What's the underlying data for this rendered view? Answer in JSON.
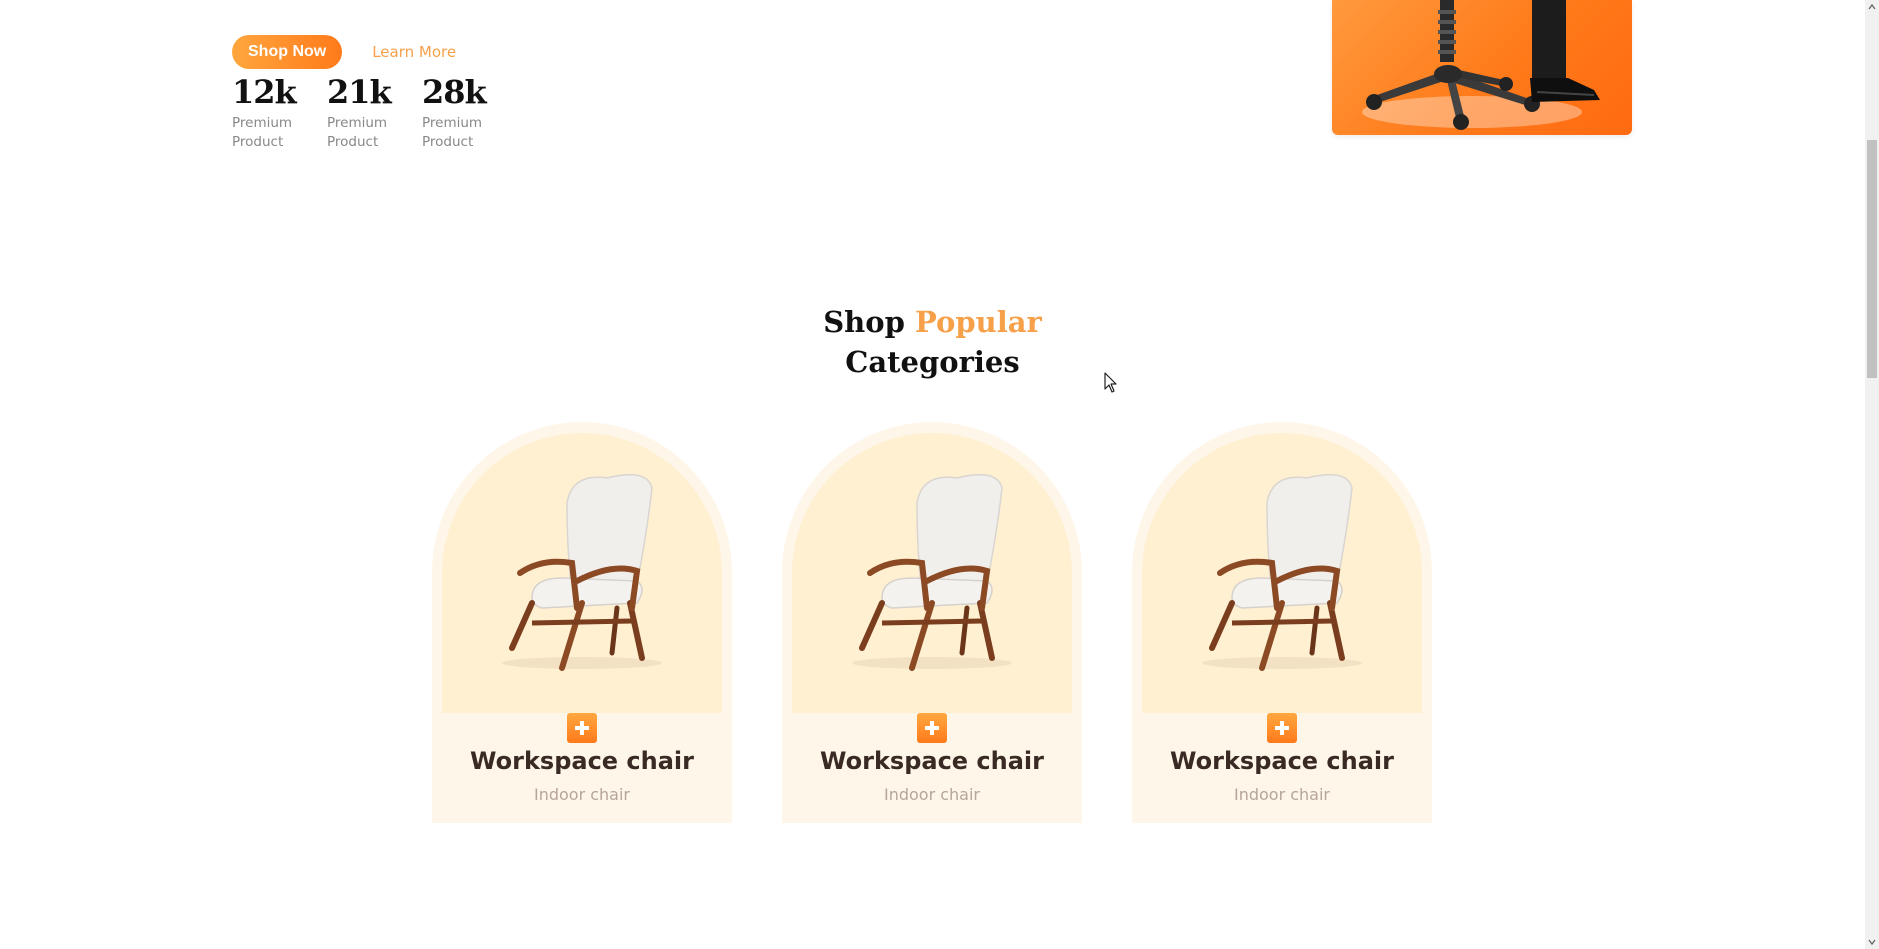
{
  "hero": {
    "shop_label": "Shop Now",
    "learn_label": "Learn More",
    "stats": [
      {
        "value": "12k",
        "label": "Premium Product"
      },
      {
        "value": "21k",
        "label": "Premium Product"
      },
      {
        "value": "28k",
        "label": "Premium Product"
      }
    ]
  },
  "section": {
    "title_main": "Shop",
    "title_accent": "Popular",
    "title_end": "Categories"
  },
  "cards": [
    {
      "title": "Workspace chair",
      "subtitle": "Indoor chair"
    },
    {
      "title": "Workspace chair",
      "subtitle": "Indoor chair"
    },
    {
      "title": "Workspace chair",
      "subtitle": "Indoor chair"
    }
  ],
  "colors": {
    "accent": "#f7a04a",
    "brand_orange": "#ff7a1a",
    "card_bg": "#fff6ea",
    "card_image_bg": "#fff0d2"
  },
  "icons": {
    "add": "plus-icon",
    "cursor": "mouse-pointer-icon"
  }
}
